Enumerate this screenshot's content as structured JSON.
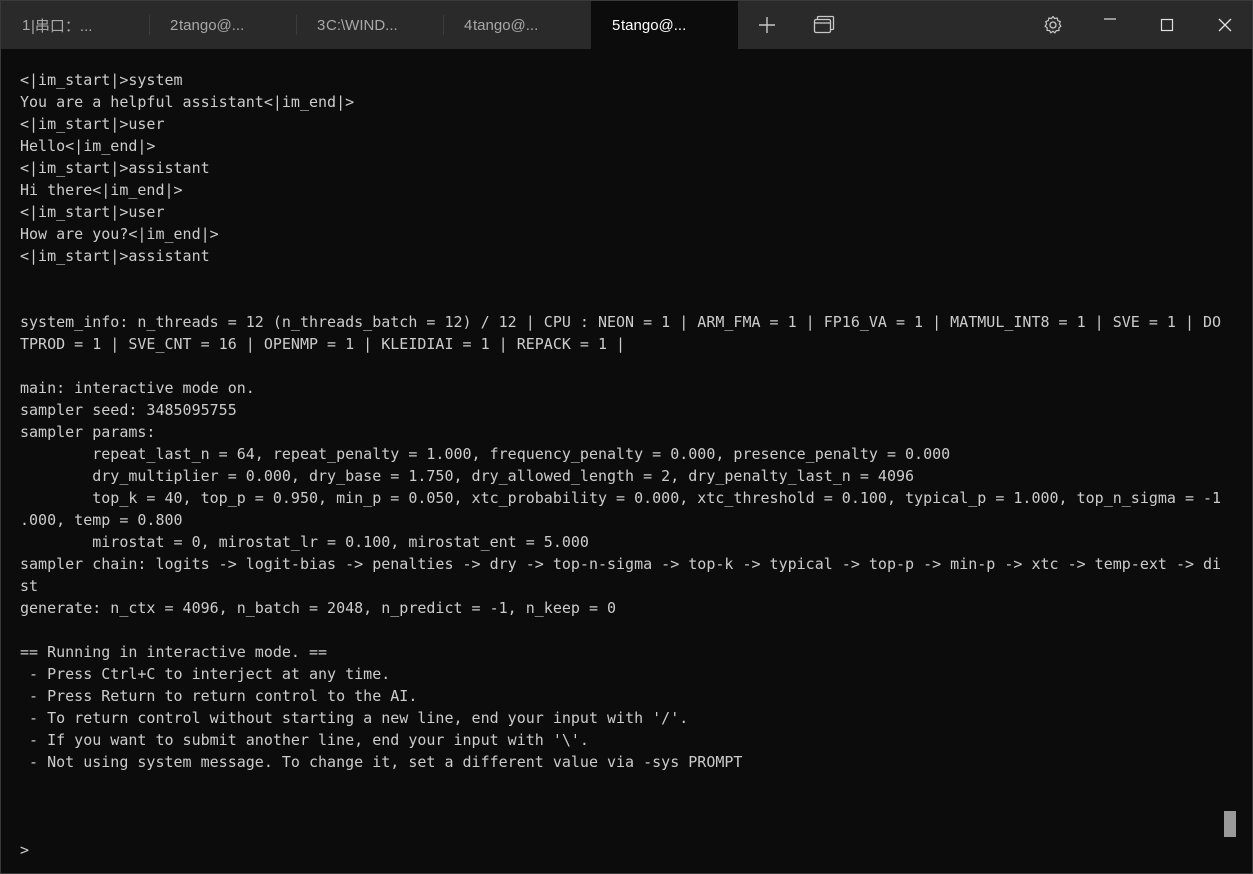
{
  "tabs": [
    {
      "num": "1",
      "title": "|串口：..."
    },
    {
      "num": "2",
      "title": "tango@..."
    },
    {
      "num": "3",
      "title": "C:\\WIND..."
    },
    {
      "num": "4",
      "title": "tango@..."
    },
    {
      "num": "5",
      "title": "tango@..."
    }
  ],
  "active_tab": "5",
  "icons": {
    "new_tab": "plus-icon",
    "tab_menu": "tabs-overview-icon",
    "settings": "gear-icon",
    "minimize": "minimize-icon",
    "maximize": "maximize-icon",
    "close": "close-icon"
  },
  "colors": {
    "terminal_bg": "#0c0c0c",
    "tabbar_bg": "#2a2a2a",
    "text": "#cccccc"
  },
  "terminal": {
    "lines": [
      "<|im_start|>system",
      "You are a helpful assistant<|im_end|>",
      "<|im_start|>user",
      "Hello<|im_end|>",
      "<|im_start|>assistant",
      "Hi there<|im_end|>",
      "<|im_start|>user",
      "How are you?<|im_end|>",
      "<|im_start|>assistant",
      "",
      "",
      "system_info: n_threads = 12 (n_threads_batch = 12) / 12 | CPU : NEON = 1 | ARM_FMA = 1 | FP16_VA = 1 | MATMUL_INT8 = 1 | SVE = 1 | DO",
      "TPROD = 1 | SVE_CNT = 16 | OPENMP = 1 | KLEIDIAI = 1 | REPACK = 1 |",
      "",
      "main: interactive mode on.",
      "sampler seed: 3485095755",
      "sampler params:",
      "        repeat_last_n = 64, repeat_penalty = 1.000, frequency_penalty = 0.000, presence_penalty = 0.000",
      "        dry_multiplier = 0.000, dry_base = 1.750, dry_allowed_length = 2, dry_penalty_last_n = 4096",
      "        top_k = 40, top_p = 0.950, min_p = 0.050, xtc_probability = 0.000, xtc_threshold = 0.100, typical_p = 1.000, top_n_sigma = -1",
      ".000, temp = 0.800",
      "        mirostat = 0, mirostat_lr = 0.100, mirostat_ent = 5.000",
      "sampler chain: logits -> logit-bias -> penalties -> dry -> top-n-sigma -> top-k -> typical -> top-p -> min-p -> xtc -> temp-ext -> di",
      "st",
      "generate: n_ctx = 4096, n_batch = 2048, n_predict = -1, n_keep = 0",
      "",
      "== Running in interactive mode. ==",
      " - Press Ctrl+C to interject at any time.",
      " - Press Return to return control to the AI.",
      " - To return control without starting a new line, end your input with '/'.",
      " - If you want to submit another line, end your input with '\\'.",
      " - Not using system message. To change it, set a different value via -sys PROMPT",
      "",
      "",
      "",
      "> "
    ]
  }
}
